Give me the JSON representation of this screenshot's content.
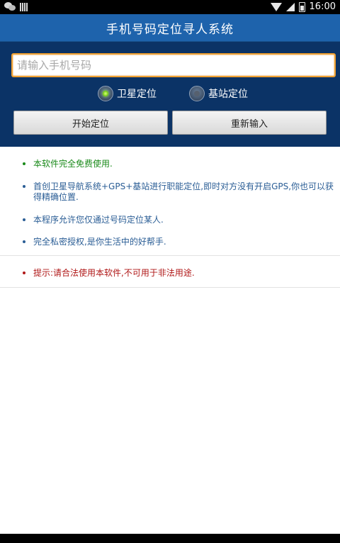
{
  "status_bar": {
    "time": "16:00"
  },
  "app": {
    "title": "手机号码定位寻人系统"
  },
  "search": {
    "placeholder": "请输入手机号码",
    "value": ""
  },
  "radios": [
    {
      "label": "卫星定位",
      "checked": true
    },
    {
      "label": "基站定位",
      "checked": false
    }
  ],
  "buttons": {
    "start": "开始定位",
    "reset": "重新输入"
  },
  "info_items": [
    {
      "text": "本软件完全免费使用.",
      "color": "#1a8a1a"
    },
    {
      "text": "首创卫星导航系统+GPS+基站进行职能定位,即时对方没有开启GPS,你也可以获得精确位置.",
      "color": "#2a5d95"
    },
    {
      "text": "本程序允许您仅通过号码定位某人.",
      "color": "#2a5d95"
    },
    {
      "text": "完全私密授权,是你生活中的好帮手.",
      "color": "#2a5d95"
    }
  ],
  "warning": {
    "text": "提示:请合法使用本软件,不可用于非法用途.",
    "color": "#b01818"
  },
  "colors": {
    "title_bar": "#1e63ac",
    "panel": "#0b3366",
    "input_border": "#f0a030"
  }
}
